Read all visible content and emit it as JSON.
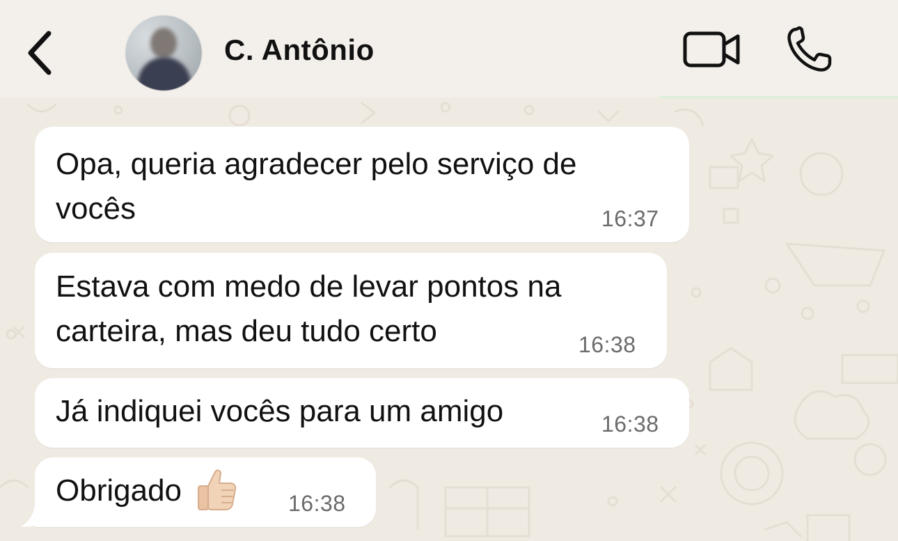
{
  "header": {
    "contact_name": "C. Antônio",
    "back_icon": "chevron-left-icon",
    "video_icon": "video-camera-icon",
    "call_icon": "phone-icon"
  },
  "messages": [
    {
      "lines": [
        "Opa, queria agradecer pelo serviço de",
        "vocês"
      ],
      "time": "16:37"
    },
    {
      "lines": [
        "Estava com medo de levar pontos na",
        "carteira, mas deu tudo certo"
      ],
      "time": "16:38"
    },
    {
      "lines": [
        "Já indiquei vocês para um amigo"
      ],
      "time": "16:38"
    },
    {
      "lines": [
        "Obrigado"
      ],
      "emoji": "thumbs-up-icon",
      "time": "16:38"
    }
  ],
  "colors": {
    "background": "#efeae2",
    "bubble": "#ffffff",
    "timestamp": "#6b6b6b"
  }
}
